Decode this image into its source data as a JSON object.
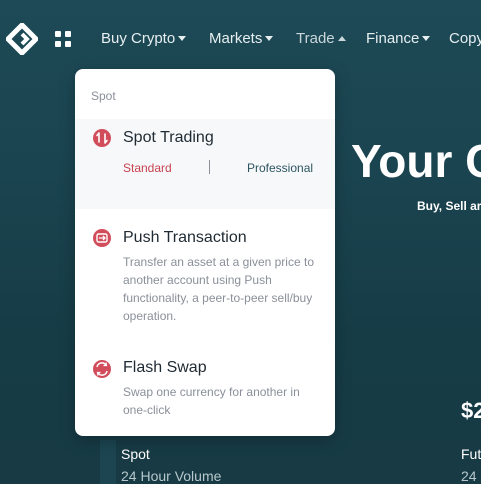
{
  "nav": {
    "items": [
      {
        "label": "Buy Crypto"
      },
      {
        "label": "Markets"
      },
      {
        "label": "Trade"
      },
      {
        "label": "Finance"
      },
      {
        "label": "Copy"
      }
    ]
  },
  "hero": {
    "title": "Your C",
    "subtitle": "Buy, Sell ar"
  },
  "stats": {
    "value": "$2",
    "spot_title": "Spot",
    "spot_label": "24 Hour Volume",
    "fut_title": "Fut",
    "fut_label": "24"
  },
  "dropdown": {
    "section": "Spot",
    "spot_trading": {
      "title": "Spot Trading",
      "standard": "Standard",
      "separator": "|",
      "professional": "Professional"
    },
    "push": {
      "title": "Push Transaction",
      "desc": "Transfer an asset at a given price to another account using Push functionality, a peer-to-peer sell/buy operation."
    },
    "swap": {
      "title": "Flash Swap",
      "desc": "Swap one currency for another in one-click"
    }
  },
  "colors": {
    "accent": "#c8434f",
    "background": "#1a4450"
  }
}
